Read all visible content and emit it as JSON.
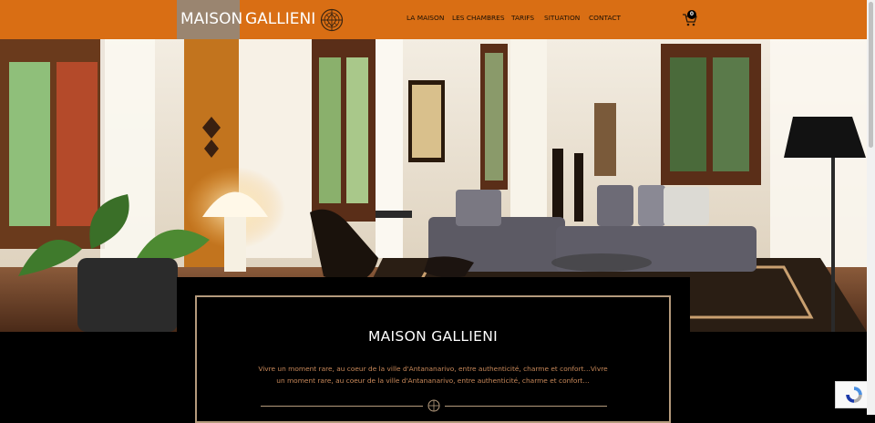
{
  "header": {
    "logo_word1": "MAISON",
    "logo_word2": "GALLIENI",
    "nav": [
      {
        "label": "LA MAISON"
      },
      {
        "label": "LES CHAMBRES"
      },
      {
        "label": "TARIFS"
      },
      {
        "label": "SITUATION"
      },
      {
        "label": "CONTACT"
      }
    ],
    "cart_count": "0"
  },
  "hero": {
    "title": "MAISON GALLIENI",
    "description": "Vivre un moment rare, au coeur de la ville d'Antananarivo, entre authenticité, charme et confort…Vivre un moment rare, au coeur de la ville d'Antananarivo, entre authenticité, charme et confort…"
  },
  "colors": {
    "header_bg": "#d96e14",
    "logo_box": "#9a8570",
    "accent_gold": "#b49a7c",
    "text_orange": "#c9895a"
  },
  "icons": [
    "logo-emblem-icon",
    "cart-icon",
    "divider-emblem-icon",
    "recaptcha-icon"
  ]
}
